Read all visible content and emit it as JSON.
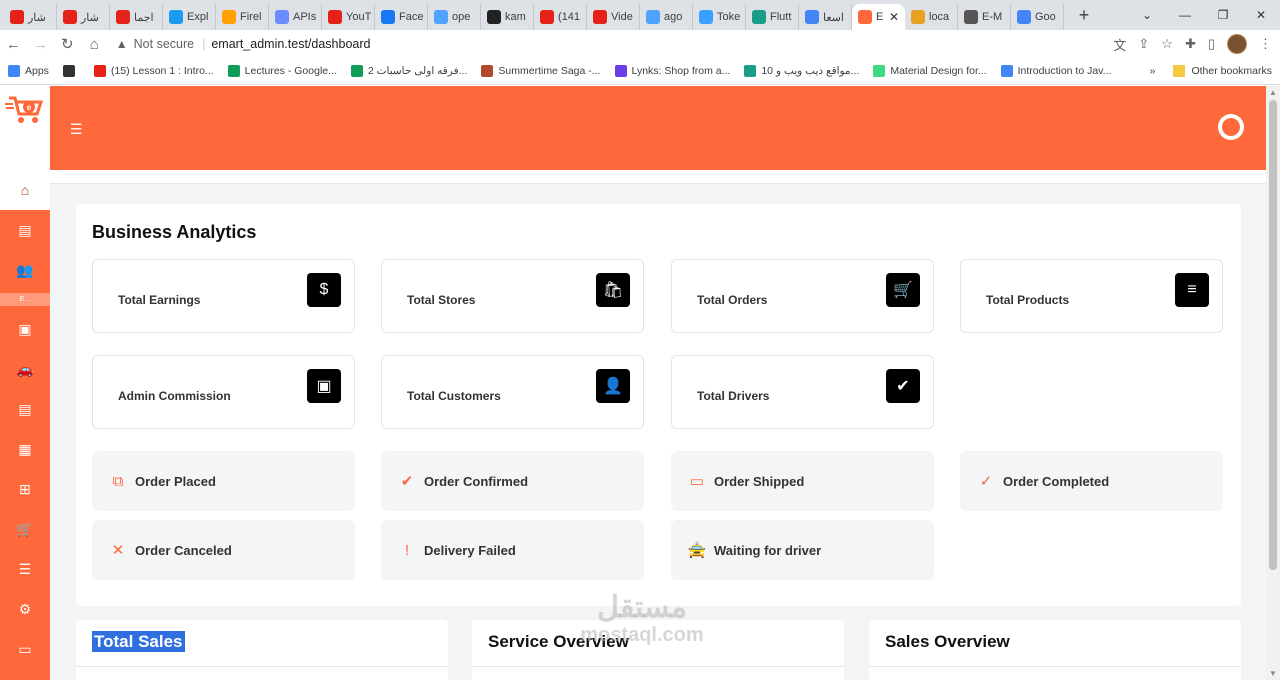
{
  "browser": {
    "tabs": [
      {
        "label": "شار",
        "color": "#e62117"
      },
      {
        "label": "شار",
        "color": "#e62117"
      },
      {
        "label": "اجما",
        "color": "#e62117"
      },
      {
        "label": "Expl",
        "color": "#1d9bf0"
      },
      {
        "label": "Firel",
        "color": "#ffa000"
      },
      {
        "label": "APIs",
        "color": "#6a8cff"
      },
      {
        "label": "YouT",
        "color": "#e62117"
      },
      {
        "label": "Face",
        "color": "#1877f2"
      },
      {
        "label": "ope",
        "color": "#4da3ff"
      },
      {
        "label": "kam",
        "color": "#222222"
      },
      {
        "label": "(141",
        "color": "#e62117"
      },
      {
        "label": "Vide",
        "color": "#e62117"
      },
      {
        "label": "ago",
        "color": "#4da3ff"
      },
      {
        "label": "Toke",
        "color": "#3aa0ff"
      },
      {
        "label": "Flutt",
        "color": "#1a9e8a"
      },
      {
        "label": "اسعا",
        "color": "#4285f4"
      },
      {
        "label": "E",
        "color": "#ff683a",
        "active": true
      },
      {
        "label": "loca",
        "color": "#e8a020"
      },
      {
        "label": "E-M",
        "color": "#555555"
      },
      {
        "label": "Goo",
        "color": "#4285f4"
      }
    ],
    "url_warning": "Not secure",
    "url": "emart_admin.test/dashboard",
    "bookmarks": [
      {
        "label": "Apps",
        "color": "#4285f4"
      },
      {
        "label": "",
        "color": "#333333"
      },
      {
        "label": "(15) Lesson 1 : Intro...",
        "color": "#e62117"
      },
      {
        "label": "Lectures - Google...",
        "color": "#0f9d58"
      },
      {
        "label": "فرقه اولى حاسبات 2...",
        "color": "#0f9d58"
      },
      {
        "label": "Summertime Saga -...",
        "color": "#b04a2a"
      },
      {
        "label": "Lynks: Shop from a...",
        "color": "#6a3de8"
      },
      {
        "label": "10 مواقع ديب ويب و...",
        "color": "#1a9e8a"
      },
      {
        "label": "Material Design for...",
        "color": "#3ddc84"
      },
      {
        "label": "Introduction to Jav...",
        "color": "#4285f4"
      }
    ],
    "bookmarks_more": "»",
    "other_bookmarks": "Other bookmarks"
  },
  "sidebar": {
    "group_label": "E..."
  },
  "dashboard": {
    "section_title": "Business Analytics",
    "stats": [
      {
        "label": "Total Earnings",
        "icon": "$"
      },
      {
        "label": "Total Stores",
        "icon": "🛍"
      },
      {
        "label": "Total Orders",
        "icon": "🛒"
      },
      {
        "label": "Total Products",
        "icon": "≡"
      },
      {
        "label": "Admin Commission",
        "icon": "▣"
      },
      {
        "label": "Total Customers",
        "icon": "👤"
      },
      {
        "label": "Total Drivers",
        "icon": "✔"
      }
    ],
    "statuses": [
      {
        "label": "Order Placed",
        "icon": "⧉"
      },
      {
        "label": "Order Confirmed",
        "icon": "✔"
      },
      {
        "label": "Order Shipped",
        "icon": "▭"
      },
      {
        "label": "Order Completed",
        "icon": "✓"
      },
      {
        "label": "Order Canceled",
        "icon": "✕"
      },
      {
        "label": "Delivery Failed",
        "icon": "!"
      },
      {
        "label": "Waiting for driver",
        "icon": "🚖"
      }
    ],
    "bottom_cards": [
      {
        "title": "Total Sales"
      },
      {
        "title": "Service Overview"
      },
      {
        "title": "Sales Overview"
      }
    ]
  },
  "watermark": {
    "line1": "مستقل",
    "line2": "mostaql.com"
  }
}
